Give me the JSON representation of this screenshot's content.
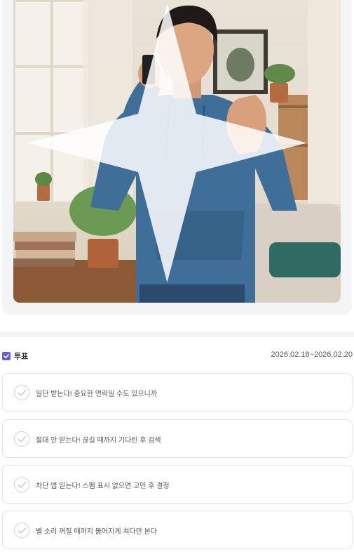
{
  "image": {
    "description_icon": "sparkle-icon"
  },
  "poll": {
    "icon": "checkbox-icon",
    "title": "투표",
    "date_range": "2026.02.18~2026.02.20",
    "options": [
      {
        "label": "일단 받는다! 중요한 연락일 수도 있으니까"
      },
      {
        "label": "절대 안 받는다! 끊길 때까지 기다린 후 검색"
      },
      {
        "label": "차단 앱 믿는다! 스팸 표시 없으면 고민 후 결정"
      },
      {
        "label": "벨 소리 꺼질 때까지 뚫어지게 쳐다만 본다"
      }
    ]
  },
  "colors": {
    "accent": "#6b5bd6",
    "card_bg": "#f3f4f6",
    "border": "#e3e3e3"
  }
}
